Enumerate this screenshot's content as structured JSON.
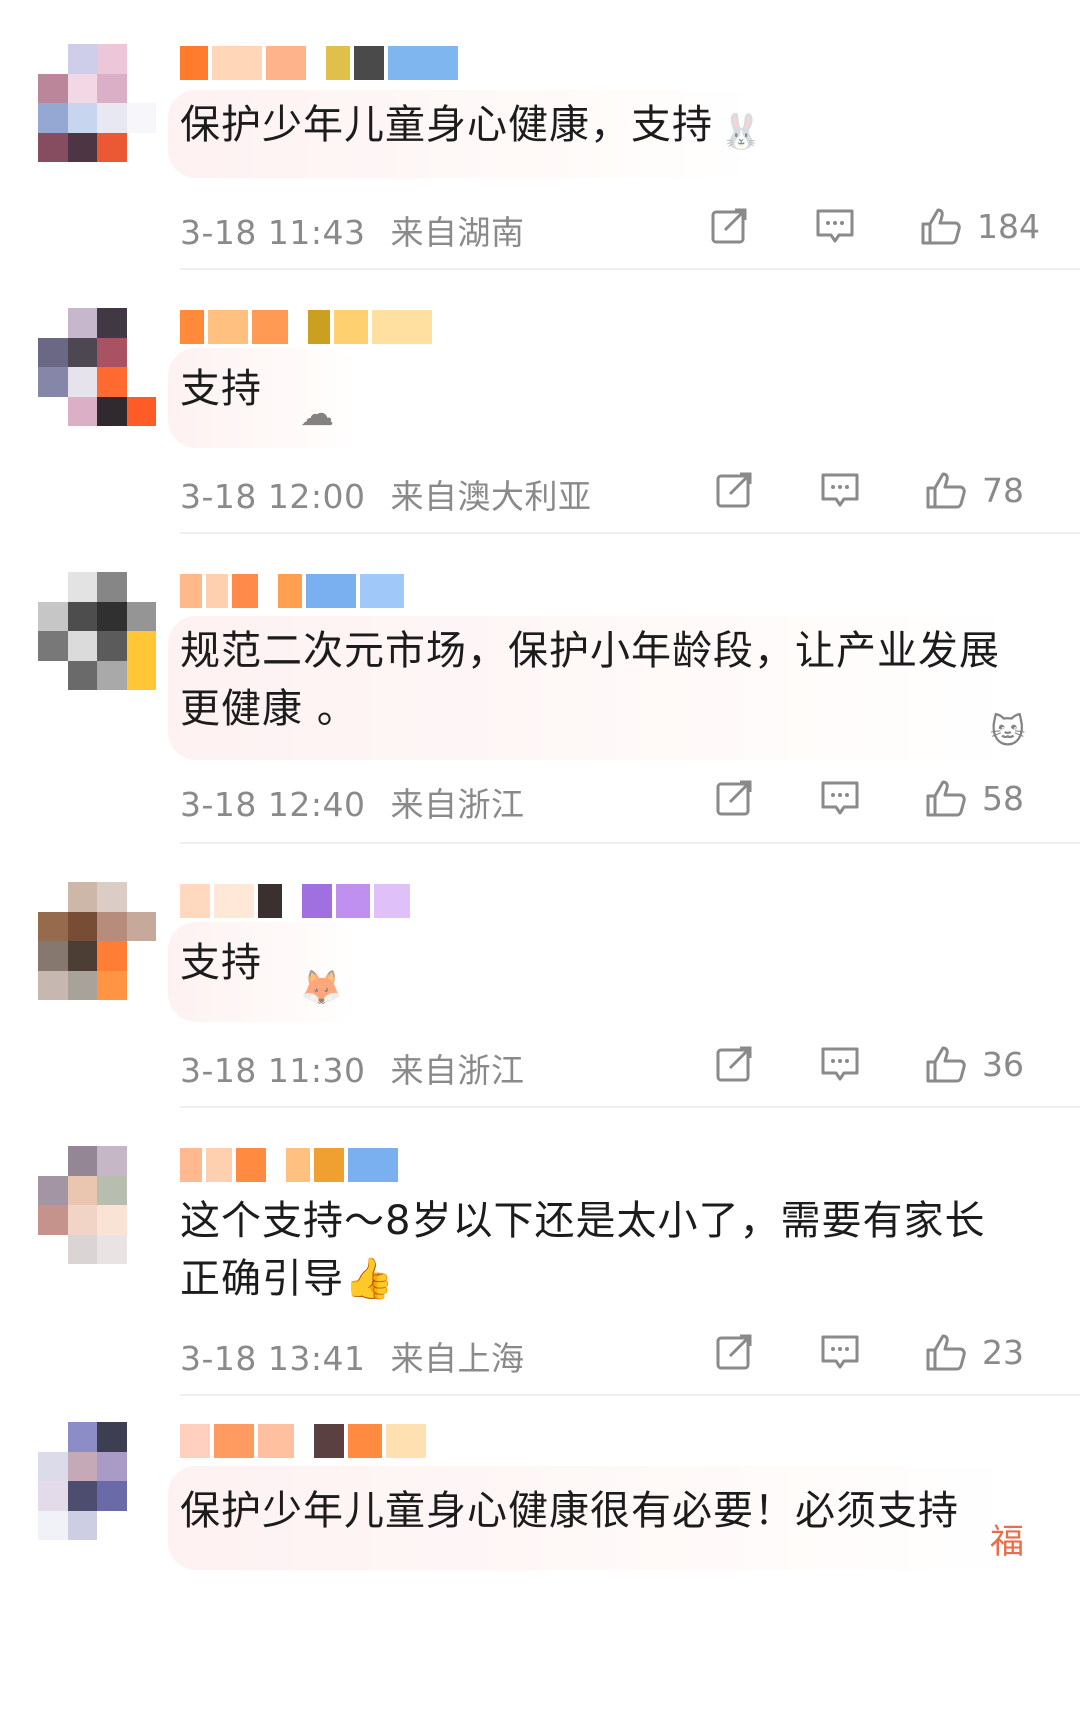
{
  "comments": [
    {
      "text": "保护少年儿童身心健康，支持",
      "time": "3-18 11:43",
      "location": "来自湖南",
      "likes": "184",
      "avatar_colors": [
        "#ffffff",
        "#c9c9e8",
        "#eac2d6",
        "#ffffff",
        "#b47a90",
        "#f1d4e2",
        "#d8a8c0",
        "#ffffff",
        "#8a9ecf",
        "#c3d1ee",
        "#e6e6f2",
        "#f6f6fb",
        "#7a3a50",
        "#3a2030",
        "#e8481e",
        "#ffffff"
      ],
      "name_colors": [
        "#ff7b2e",
        "#ffd6b8",
        "#ffb38a",
        "#e0c04a",
        "#4a4a4a",
        "#7fb6f0"
      ]
    },
    {
      "text": "支持",
      "time": "3-18 12:00",
      "location": "来自澳大利亚",
      "likes": "78",
      "avatar_colors": [
        "#ffffff",
        "#c0b0c8",
        "#2c2430",
        "#ffffff",
        "#5a5878",
        "#3a3440",
        "#a04050",
        "#ffffff",
        "#7a7aa0",
        "#e4e0ea",
        "#ff5a1a",
        "#ffffff",
        "#ffffff",
        "#d8a8c0",
        "#1a1418",
        "#ff4a10"
      ],
      "name_colors": [
        "#ff8a3a",
        "#ffc080",
        "#ff9a55",
        "#c9a020",
        "#ffd070",
        "#ffe0a0"
      ]
    },
    {
      "text": "规范二次元市场，保护小年龄段，让产业发展更健康 。",
      "time": "3-18 12:40",
      "location": "来自浙江",
      "likes": "58",
      "avatar_colors": [
        "#ffffff",
        "#e0e0e0",
        "#7a7a7a",
        "#ffffff",
        "#c0c0c0",
        "#3a3a3a",
        "#1a1a1a",
        "#8a8a8a",
        "#6a6a6a",
        "#d8d8d8",
        "#4a4a4a",
        "#ffc020",
        "#ffffff",
        "#5a5a5a",
        "#a0a0a0",
        "#ffc020"
      ],
      "name_colors": [
        "#ffb88a",
        "#ffd0b0",
        "#ff8a4a",
        "#ffa050",
        "#7ab0f0",
        "#a0c8f8"
      ]
    },
    {
      "text": "支持",
      "time": "3-18 11:30",
      "location": "来自浙江",
      "likes": "36",
      "avatar_colors": [
        "#ffffff",
        "#c8b0a0",
        "#d8c8c0",
        "#ffffff",
        "#8a5a3a",
        "#6a3a20",
        "#b08070",
        "#c0a090",
        "#7a6a60",
        "#3a2a20",
        "#ff7020",
        "#ffffff",
        "#c0b0a8",
        "#a09890",
        "#ff8a30",
        "#ffffff"
      ],
      "name_colors": [
        "#ffd8c0",
        "#ffe8d8",
        "#3a3030",
        "#a070e0",
        "#c090f0",
        "#e0c0f8"
      ]
    },
    {
      "text": "这个支持～8岁以下还是太小了，需要有家长正确引导👍",
      "time": "3-18 13:41",
      "location": "来自上海",
      "likes": "23",
      "avatar_colors": [
        "#ffffff",
        "#8a7a8a",
        "#c0b0c0",
        "#ffffff",
        "#9a8a9a",
        "#e8c0a8",
        "#b0b8a8",
        "#ffffff",
        "#c08880",
        "#f0d0c0",
        "#f8e0d0",
        "#ffffff",
        "#ffffff",
        "#d8d0d0",
        "#e8e0e0",
        "#ffffff"
      ],
      "name_colors": [
        "#ffb890",
        "#ffd0b0",
        "#ff8a40",
        "#ffc080",
        "#f0a030",
        "#7ab0f0"
      ]
    },
    {
      "text": "保护少年儿童身心健康很有必要！必须支持",
      "time": "",
      "location": "",
      "likes": "",
      "avatar_colors": [
        "#ffffff",
        "#8080c0",
        "#2a2a40",
        "#ffffff",
        "#d8d8e8",
        "#c0a0b0",
        "#a090c0",
        "#ffffff",
        "#e0d8e8",
        "#3a3a60",
        "#5a5aa0",
        "#ffffff",
        "#f0f0f8",
        "#c8c8e0",
        "#ffffff",
        "#ffffff"
      ],
      "name_colors": [
        "#ffd0c0",
        "#ff9a60",
        "#ffc0a0",
        "#5a4040",
        "#ff8a40",
        "#ffe0b0"
      ]
    }
  ],
  "icons": {
    "share": "share-icon",
    "reply": "comment-icon",
    "like": "thumbs-up-icon"
  },
  "colors": {
    "meta_text": "#8a8a8a",
    "divider": "#efefef",
    "bubble": "#fdeff0"
  }
}
